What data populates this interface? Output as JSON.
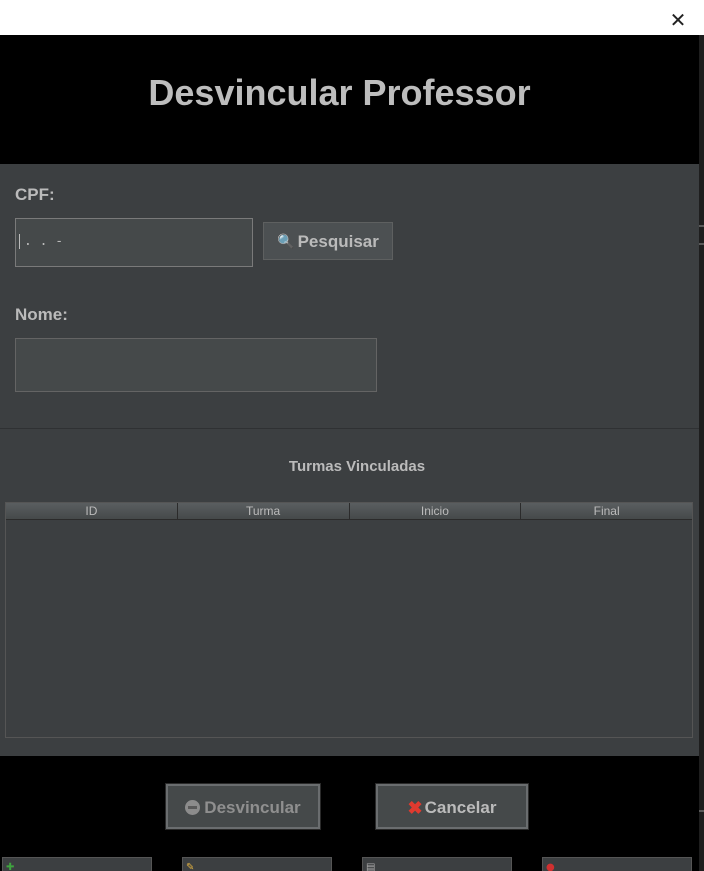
{
  "window": {
    "close_glyph": "✕"
  },
  "header": {
    "title": "Desvincular Professor"
  },
  "form": {
    "cpf_label": "CPF:",
    "cpf_mask": ". . -",
    "search_label": "Pesquisar",
    "nome_label": "Nome:",
    "nome_value": ""
  },
  "table": {
    "title": "Turmas Vinculadas",
    "columns": [
      "ID",
      "Turma",
      "Inicio",
      "Final"
    ],
    "rows": []
  },
  "footer": {
    "unlink_label": "Desvincular",
    "cancel_label": "Cancelar"
  },
  "icons": {
    "search": "search-icon",
    "unlink": "minus-circle-icon",
    "cancel": "red-x-icon",
    "close": "close-icon"
  },
  "colors": {
    "panel_bg": "#3c3f41",
    "header_bg": "#000000",
    "text": "#bbbbbb",
    "cancel_icon": "#e03a2f"
  }
}
